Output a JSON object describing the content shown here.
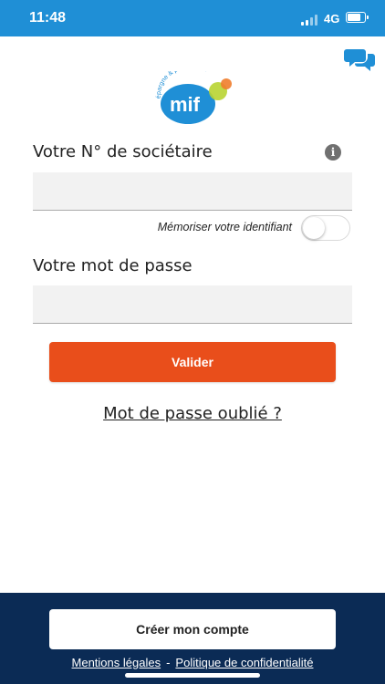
{
  "status_bar": {
    "time": "11:48",
    "network": "4G",
    "battery_level": 0.85,
    "color": "#1f8fd6"
  },
  "header": {
    "chat_icon": "chat-bubbles-icon",
    "logo": {
      "brand": "mif",
      "tagline": "épargne & prévoyance",
      "primary_color": "#1f8fd6",
      "accent_colors": [
        "#b8d432",
        "#f07d2c"
      ]
    }
  },
  "login_form": {
    "member_number": {
      "label": "Votre N° de sociétaire",
      "value": "",
      "placeholder": "",
      "info_icon": "i"
    },
    "remember": {
      "label": "Mémoriser votre identifiant",
      "checked": false
    },
    "password": {
      "label": "Votre mot de passe",
      "value": "",
      "placeholder": ""
    },
    "submit_label": "Valider",
    "submit_color": "#e94e1b",
    "forgot_label": "Mot de passe oublié ?"
  },
  "footer": {
    "background": "#0b2b55",
    "create_account_label": "Créer mon compte",
    "links": {
      "legal": "Mentions légales",
      "separator": "-",
      "privacy": "Politique de confidentialité"
    }
  }
}
